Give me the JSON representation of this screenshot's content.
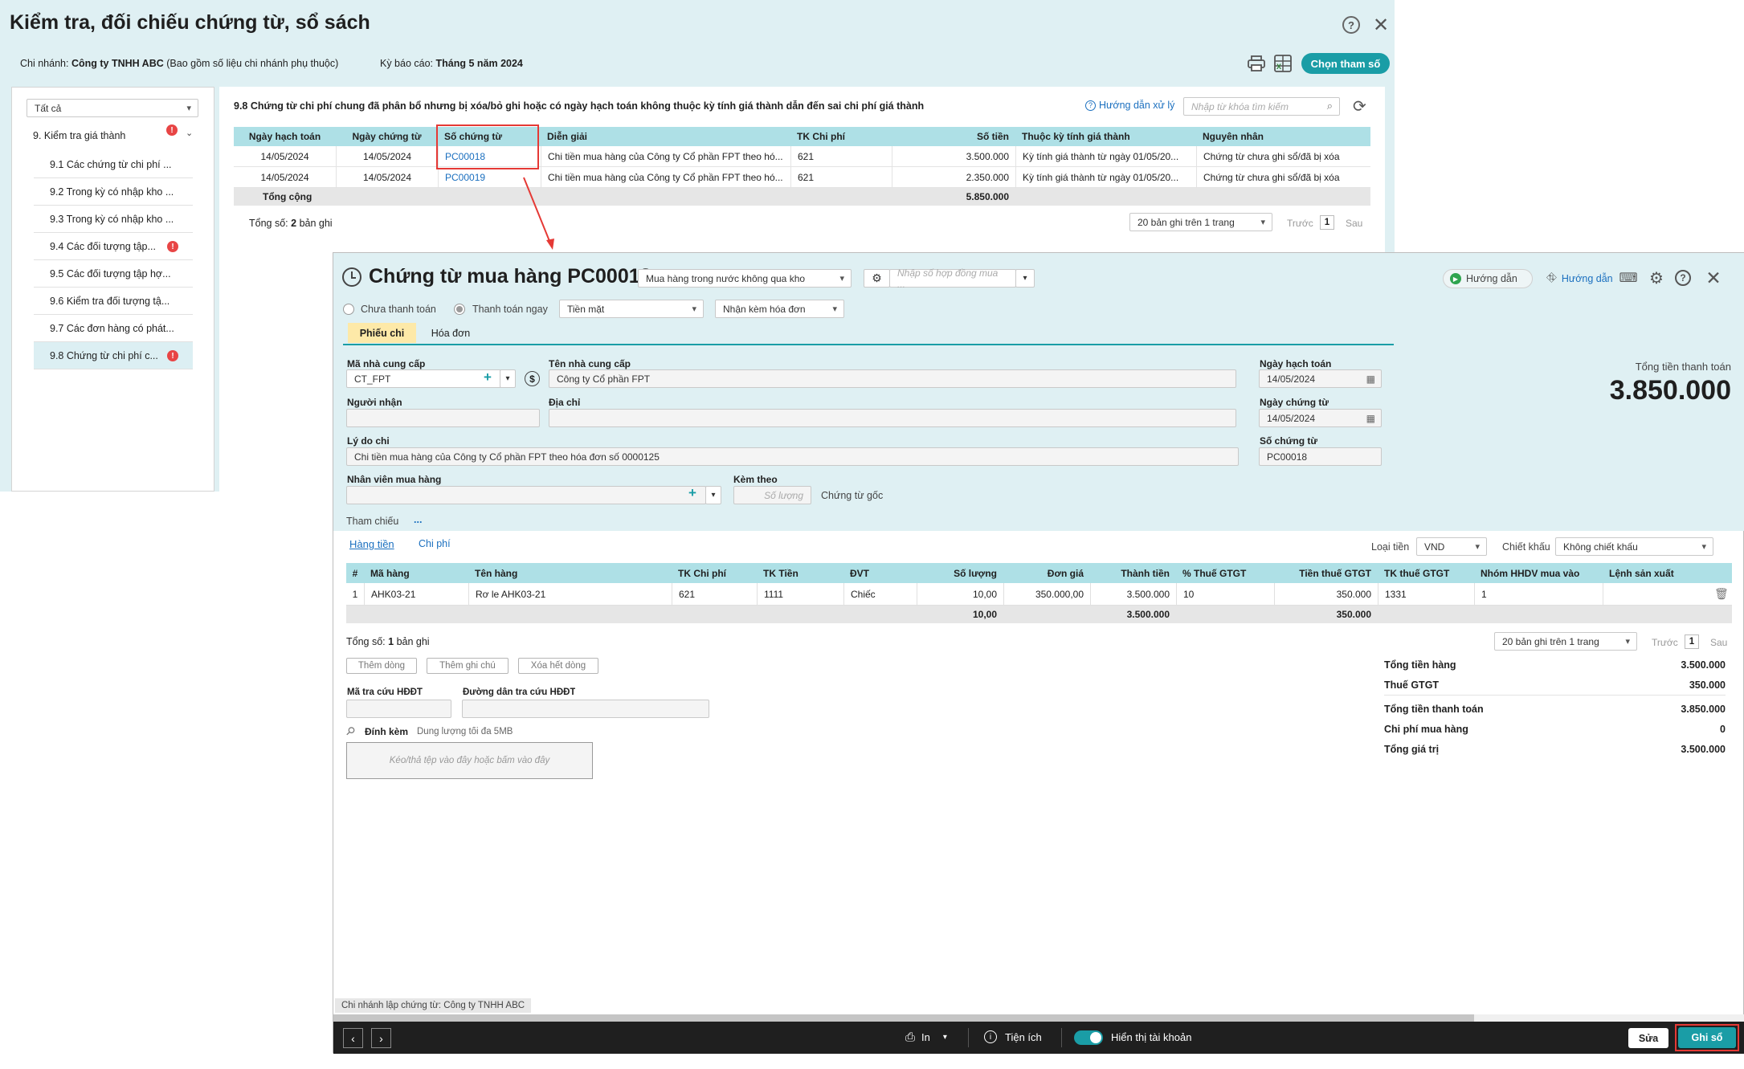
{
  "back": {
    "title": "Kiểm tra, đối chiếu chứng từ, sổ sách",
    "branch_label": "Chi nhánh:",
    "branch_value": "Công ty TNHH ABC",
    "branch_note": "(Bao gồm số liệu chi nhánh phụ thuộc)",
    "period_label": "Kỳ báo cáo:",
    "period_value": "Tháng 5 năm 2024",
    "params_button": "Chọn tham số",
    "filter_value": "Tất cả",
    "sidebar": {
      "group": "9. Kiểm tra giá thành",
      "items": [
        {
          "label": "9.1 Các chứng từ chi phí ...",
          "error": false
        },
        {
          "label": "9.2 Trong kỳ có nhập kho ...",
          "error": false
        },
        {
          "label": "9.3 Trong kỳ có nhập kho ...",
          "error": false
        },
        {
          "label": "9.4 Các đối tượng tập...",
          "error": true
        },
        {
          "label": "9.5 Các đối tượng tập hợ...",
          "error": false
        },
        {
          "label": "9.6 Kiểm tra đối tượng tậ...",
          "error": false
        },
        {
          "label": "9.7 Các đơn hàng có phát...",
          "error": false
        },
        {
          "label": "9.8 Chứng từ chi phí c...",
          "error": true
        }
      ]
    },
    "section_title": "9.8 Chứng từ chi phí chung đã phân bổ nhưng bị xóa/bỏ ghi hoặc có ngày hạch toán không thuộc kỳ tính giá thành dẫn đến sai chi phí giá thành",
    "guide_link": "Hướng dẫn xử lý",
    "search_placeholder": "Nhập từ khóa tìm kiếm",
    "table": {
      "headers": [
        "Ngày hạch toán",
        "Ngày chứng từ",
        "Số chứng từ",
        "Diễn giải",
        "TK Chi phí",
        "Số tiền",
        "Thuộc kỳ tính giá thành",
        "Nguyên nhân"
      ],
      "rows": [
        [
          "14/05/2024",
          "14/05/2024",
          "PC00018",
          "Chi tiền mua hàng của Công ty Cổ phần FPT theo hó...",
          "621",
          "3.500.000",
          "Kỳ tính giá thành từ ngày 01/05/20...",
          "Chứng từ chưa ghi sổ/đã bị xóa"
        ],
        [
          "14/05/2024",
          "14/05/2024",
          "PC00019",
          "Chi tiền mua hàng của Công ty Cổ phần FPT theo hó...",
          "621",
          "2.350.000",
          "Kỳ tính giá thành từ ngày 01/05/20...",
          "Chứng từ chưa ghi sổ/đã bị xóa"
        ]
      ],
      "total_label": "Tổng cộng",
      "total_value": "5.850.000"
    },
    "count_label": "Tổng số:",
    "count_value": "2",
    "count_unit": "bản ghi",
    "page_size": "20 bản ghi trên 1 trang",
    "prev": "Trước",
    "page": "1",
    "next": "Sau"
  },
  "dialog": {
    "title": "Chứng từ mua hàng PC00018",
    "purchase_type": "Mua hàng trong nước không qua kho",
    "contract_placeholder": "Nhập số hợp đồng mua ...",
    "guide1": "Hướng dẫn",
    "guide2": "Hướng dẫn",
    "radio_unpaid": "Chưa thanh toán",
    "radio_paid": "Thanh toán ngay",
    "payment_method": "Tiền mặt",
    "invoice_option": "Nhận kèm hóa đơn",
    "tab_payment": "Phiếu chi",
    "tab_invoice": "Hóa đơn",
    "supplier_code_label": "Mã nhà cung cấp",
    "supplier_code": "CT_FPT",
    "supplier_name_label": "Tên nhà cung cấp",
    "supplier_name": "Công ty Cổ phần FPT",
    "receiver_label": "Người nhận",
    "address_label": "Địa chỉ",
    "reason_label": "Lý do chi",
    "reason": "Chi tiền mua hàng của Công ty Cổ phần FPT theo hóa đơn số 0000125",
    "buyer_label": "Nhân viên mua hàng",
    "attach_label": "Kèm theo",
    "qty_placeholder": "Số lượng",
    "original_doc": "Chứng từ gốc",
    "reference_label": "Tham chiếu",
    "reference_more": "...",
    "posting_date_label": "Ngày hạch toán",
    "posting_date": "14/05/2024",
    "doc_date_label": "Ngày chứng từ",
    "doc_date": "14/05/2024",
    "doc_no_label": "Số chứng từ",
    "doc_no": "PC00018",
    "total_pay_label": "Tổng tiền thanh toán",
    "total_pay": "3.850.000",
    "subtab_goods": "Hàng tiền",
    "subtab_cost": "Chi phí",
    "currency_label": "Loại tiền",
    "currency": "VND",
    "discount_label": "Chiết khấu",
    "discount": "Không chiết khấu",
    "grid": {
      "headers": [
        "#",
        "Mã hàng",
        "Tên hàng",
        "TK Chi phí",
        "TK Tiền",
        "ĐVT",
        "Số lượng",
        "Đơn giá",
        "Thành tiền",
        "% Thuế GTGT",
        "Tiền thuế GTGT",
        "TK thuế GTGT",
        "Nhóm HHDV mua vào",
        "Lệnh sản xuất"
      ],
      "row": [
        "1",
        "AHK03-21",
        "Rơ le AHK03-21",
        "621",
        "1111",
        "Chiếc",
        "10,00",
        "350.000,00",
        "3.500.000",
        "10",
        "350.000",
        "1331",
        "1",
        ""
      ],
      "total_qty": "10,00",
      "total_amount": "3.500.000",
      "total_tax": "350.000"
    },
    "count_label": "Tổng số:",
    "count_value": "1",
    "count_unit": "bản ghi",
    "page_size": "20 bản ghi trên 1 trang",
    "prev": "Trước",
    "page": "1",
    "next": "Sau",
    "btn_add_row": "Thêm dòng",
    "btn_add_note": "Thêm ghi chú",
    "btn_delete_all": "Xóa hết dòng",
    "lookup_code_label": "Mã tra cứu HĐĐT",
    "lookup_url_label": "Đường dẫn tra cứu HĐĐT",
    "attachment_label": "Đính kèm",
    "attachment_note": "Dung lượng tối đa 5MB",
    "drop_hint": "Kéo/thả tệp vào đây hoặc bấm vào đây",
    "summary": [
      {
        "label": "Tổng tiền hàng",
        "value": "3.500.000"
      },
      {
        "label": "Thuế GTGT",
        "value": "350.000"
      },
      {
        "label": "Tổng tiền thanh toán",
        "value": "3.850.000"
      },
      {
        "label": "Chi phí mua hàng",
        "value": "0"
      },
      {
        "label": "Tổng giá trị",
        "value": "3.500.000"
      }
    ],
    "branch_note": "Chi nhánh lập chứng từ: Công ty TNHH ABC",
    "footer": {
      "print": "In",
      "utility": "Tiện ích",
      "show_account": "Hiển thị tài khoản",
      "edit": "Sửa",
      "post": "Ghi sổ"
    }
  },
  "colors": {
    "accent": "#1a9da6",
    "header_bg": "#dff0f3",
    "table_head": "#aee0e6",
    "highlight": "#e53935"
  }
}
